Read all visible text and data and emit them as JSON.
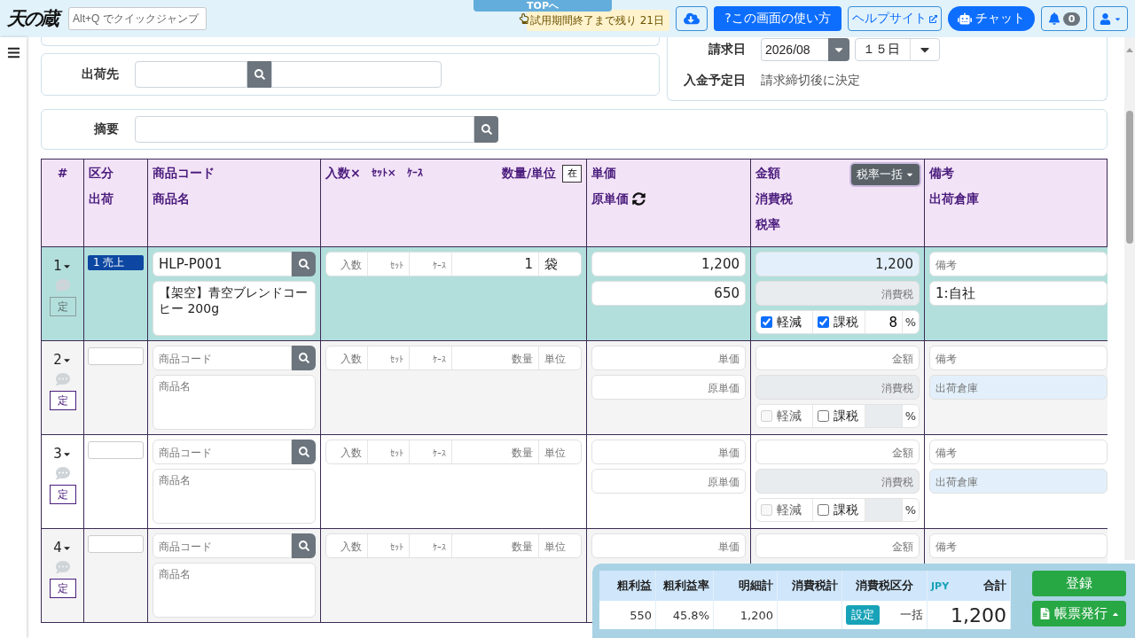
{
  "header": {
    "logo": "天の蔵",
    "quick_jump": {
      "placeholder": "Alt+Q でクイックジャンプ"
    },
    "top_link": "TOPへ",
    "trial_notice": "試用期間終了まで残り 21日",
    "howto_button": "?この画面の使い方",
    "help_button": "ヘルプサイト",
    "chat_button": "チャット",
    "notification_count": "0"
  },
  "ship_to": {
    "label": "出荷先"
  },
  "billing": {
    "date_label": "請求日",
    "month": "2026/08",
    "day": "１５日",
    "payment_label": "入金予定日",
    "payment_value": "請求締切後に決定"
  },
  "memo": {
    "label": "摘要"
  },
  "table": {
    "columns": [
      {
        "kind": "number",
        "lines": [
          "#"
        ]
      },
      {
        "kind": "text",
        "lines": [
          "区分",
          "出荷"
        ]
      },
      {
        "kind": "text",
        "lines": [
          "商品コード",
          "商品名"
        ]
      },
      {
        "kind": "quantity",
        "lines": [
          "入数×",
          "ｾｯﾄ×",
          "ｹｰｽ"
        ],
        "right": "数量/単位",
        "button": "在"
      },
      {
        "kind": "price",
        "lines": [
          "単価",
          "原単価"
        ]
      },
      {
        "kind": "amount",
        "lines": [
          "金額",
          "消費税",
          "税率"
        ],
        "button": "税率一括"
      },
      {
        "kind": "text",
        "lines": [
          "備考",
          "出荷倉庫"
        ]
      }
    ],
    "rows": [
      {
        "number": "1",
        "selected": true,
        "fixed": {
          "label": "定",
          "disabled": true
        },
        "category": "1 売上",
        "code": {
          "value": "HLP-P001"
        },
        "name": {
          "value": "【架空】青空ブレンドコーヒー 200g"
        },
        "qty": [
          {
            "placeholder": "入数"
          },
          {
            "placeholder": "ｾｯﾄ"
          },
          {
            "placeholder": "ｹｰｽ"
          }
        ],
        "quantity": {
          "value": "1"
        },
        "unit": {
          "value": "袋"
        },
        "unit_price": {
          "value": "1,200"
        },
        "cost": {
          "value": "650"
        },
        "amount": {
          "value": "1,200",
          "highlighted": true
        },
        "tax": {
          "placeholder": "消費税"
        },
        "reduced": {
          "label": "軽減",
          "checked": true,
          "disabled": false
        },
        "taxable": {
          "label": "課税",
          "checked": true,
          "disabled": false
        },
        "rate": {
          "value": "8",
          "disabled": false
        },
        "percent": "%",
        "remarks": {
          "placeholder": "備考"
        },
        "warehouse": {
          "value": "1:自社",
          "highlighted": false
        }
      },
      {
        "number": "2",
        "selected": false,
        "fixed": {
          "label": "定",
          "disabled": false
        },
        "code": {
          "placeholder": "商品コード"
        },
        "name": {
          "placeholder": "商品名"
        },
        "qty": [
          {
            "placeholder": "入数"
          },
          {
            "placeholder": "ｾｯﾄ"
          },
          {
            "placeholder": "ｹｰｽ"
          }
        ],
        "quantity": {
          "placeholder": "数量"
        },
        "unit": {
          "placeholder": "単位"
        },
        "unit_price": {
          "placeholder": "単価"
        },
        "cost": {
          "placeholder": "原単価"
        },
        "amount": {
          "placeholder": "金額",
          "highlighted": false
        },
        "tax": {
          "placeholder": "消費税"
        },
        "reduced": {
          "label": "軽減",
          "checked": false,
          "disabled": true
        },
        "taxable": {
          "label": "課税",
          "checked": false,
          "disabled": false
        },
        "rate": {
          "disabled": true
        },
        "percent": "%",
        "remarks": {
          "placeholder": "備考"
        },
        "warehouse": {
          "placeholder": "出荷倉庫",
          "highlighted": true
        }
      },
      {
        "number": "3",
        "selected": false,
        "fixed": {
          "label": "定",
          "disabled": false
        },
        "code": {
          "placeholder": "商品コード"
        },
        "name": {
          "placeholder": "商品名"
        },
        "qty": [
          {
            "placeholder": "入数"
          },
          {
            "placeholder": "ｾｯﾄ"
          },
          {
            "placeholder": "ｹｰｽ"
          }
        ],
        "quantity": {
          "placeholder": "数量"
        },
        "unit": {
          "placeholder": "単位"
        },
        "unit_price": {
          "placeholder": "単価"
        },
        "cost": {
          "placeholder": "原単価"
        },
        "amount": {
          "placeholder": "金額",
          "highlighted": false
        },
        "tax": {
          "placeholder": "消費税"
        },
        "reduced": {
          "label": "軽減",
          "checked": false,
          "disabled": true
        },
        "taxable": {
          "label": "課税",
          "checked": false,
          "disabled": false
        },
        "rate": {
          "disabled": true
        },
        "percent": "%",
        "remarks": {
          "placeholder": "備考"
        },
        "warehouse": {
          "placeholder": "出荷倉庫",
          "highlighted": true
        }
      },
      {
        "number": "4",
        "selected": false,
        "fixed": {
          "label": "定",
          "disabled": false
        },
        "code": {
          "placeholder": "商品コード"
        },
        "name": {
          "placeholder": "商品名"
        },
        "qty": [
          {
            "placeholder": "入数"
          },
          {
            "placeholder": "ｾｯﾄ"
          },
          {
            "placeholder": "ｹｰｽ"
          }
        ],
        "quantity": {
          "placeholder": "数量"
        },
        "unit": {
          "placeholder": "単位"
        },
        "unit_price": {
          "placeholder": "単価"
        },
        "amount": {
          "placeholder": "金額",
          "highlighted": false
        },
        "remarks": {
          "placeholder": "備考"
        }
      }
    ]
  },
  "summary": {
    "cells": [
      {
        "label": "粗利益",
        "value": "550"
      },
      {
        "label": "粗利益率",
        "value": "45.8%"
      },
      {
        "label": "明細計",
        "value": "1,200"
      },
      {
        "label": "消費税計"
      }
    ],
    "tax_mode": {
      "label": "消費税区分",
      "button": "設定",
      "value": "一括"
    },
    "total": {
      "currency": "JPY",
      "label": "合計",
      "value": "1,200"
    },
    "register_button": "登録",
    "report_button": "帳票発行"
  }
}
